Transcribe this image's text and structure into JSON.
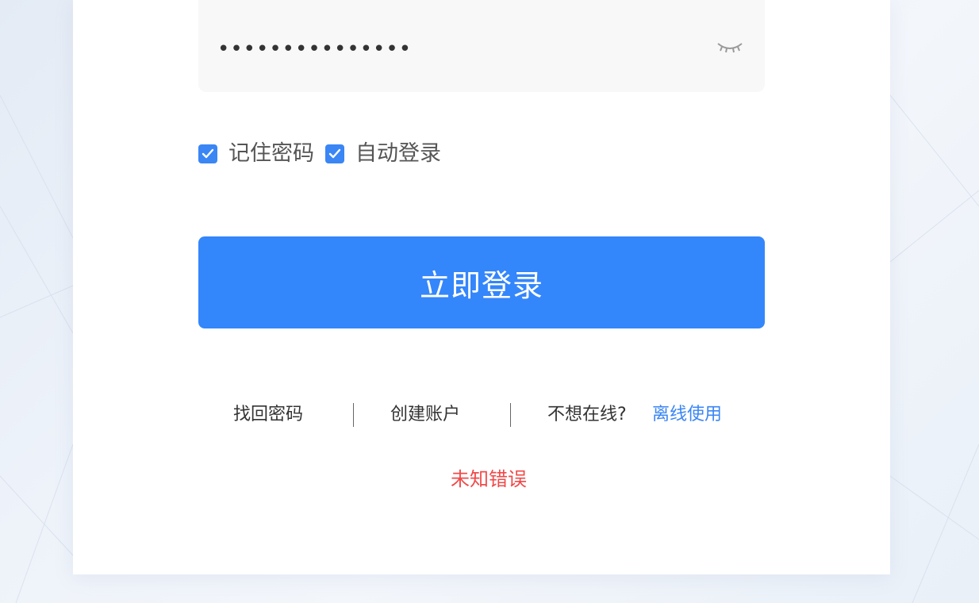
{
  "password": {
    "masked_value": "•••••••••••••••",
    "toggle_icon": "eye-closed-icon"
  },
  "options": {
    "remember_password_label": "记住密码",
    "remember_password_checked": true,
    "auto_login_label": "自动登录",
    "auto_login_checked": true
  },
  "login_button_label": "立即登录",
  "links": {
    "find_password": "找回密码",
    "create_account": "创建账户",
    "offline_prompt": "不想在线?",
    "offline_use": "离线使用"
  },
  "error_message": "未知错误",
  "colors": {
    "primary": "#3486fb",
    "checkbox": "#3a86f5",
    "error": "#f04a4a",
    "link": "#3a86f5"
  }
}
